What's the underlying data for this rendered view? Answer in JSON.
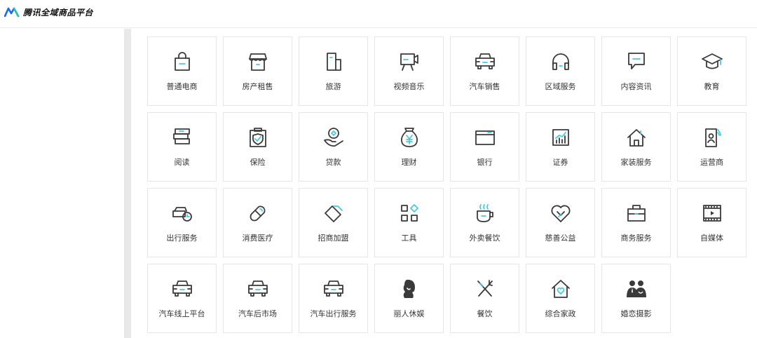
{
  "header": {
    "brand": "腾讯全域商品平台",
    "accent": "#1a66ff"
  },
  "theme": {
    "icon_stroke": "#3a3a3a",
    "icon_accent": "#4cc8e0"
  },
  "categories": [
    {
      "label": "普通电商",
      "icon": "shopping-bag-icon"
    },
    {
      "label": "房产租售",
      "icon": "storefront-icon"
    },
    {
      "label": "旅游",
      "icon": "building-icon"
    },
    {
      "label": "视频音乐",
      "icon": "video-camera-icon"
    },
    {
      "label": "汽车销售",
      "icon": "car-icon"
    },
    {
      "label": "区域服务",
      "icon": "headset-icon"
    },
    {
      "label": "内容资讯",
      "icon": "message-icon"
    },
    {
      "label": "教育",
      "icon": "graduation-cap-icon"
    },
    {
      "label": "阅读",
      "icon": "books-icon"
    },
    {
      "label": "保险",
      "icon": "insurance-shield-icon"
    },
    {
      "label": "贷款",
      "icon": "hand-coin-icon"
    },
    {
      "label": "理财",
      "icon": "money-bag-icon"
    },
    {
      "label": "银行",
      "icon": "bank-card-icon"
    },
    {
      "label": "证券",
      "icon": "stock-chart-icon"
    },
    {
      "label": "家装服务",
      "icon": "house-icon"
    },
    {
      "label": "运营商",
      "icon": "mobile-user-icon"
    },
    {
      "label": "出行服务",
      "icon": "travel-clock-icon"
    },
    {
      "label": "消费医疗",
      "icon": "capsule-icon"
    },
    {
      "label": "招商加盟",
      "icon": "tag-icon"
    },
    {
      "label": "工具",
      "icon": "apps-grid-icon"
    },
    {
      "label": "外卖餐饮",
      "icon": "coffee-cup-icon"
    },
    {
      "label": "慈善公益",
      "icon": "heart-handshake-icon"
    },
    {
      "label": "商务服务",
      "icon": "briefcase-icon"
    },
    {
      "label": "自媒体",
      "icon": "film-play-icon"
    },
    {
      "label": "汽车线上平台",
      "icon": "car-icon"
    },
    {
      "label": "汽车后市场",
      "icon": "car-icon"
    },
    {
      "label": "汽车出行服务",
      "icon": "car-icon"
    },
    {
      "label": "丽人休娱",
      "icon": "woman-profile-icon"
    },
    {
      "label": "餐饮",
      "icon": "fork-knife-icon"
    },
    {
      "label": "综合家政",
      "icon": "house-heart-icon"
    },
    {
      "label": "婚恋摄影",
      "icon": "couple-icon"
    }
  ]
}
